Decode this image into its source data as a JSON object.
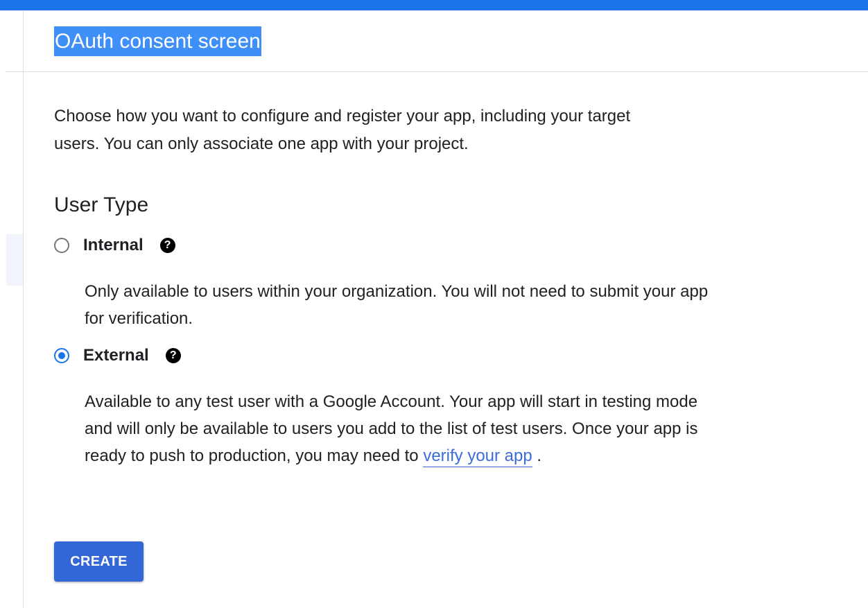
{
  "header": {
    "title": "OAuth consent screen"
  },
  "intro": {
    "text": "Choose how you want to configure and register your app, including your target users. You can only associate one app with your project."
  },
  "user_type": {
    "title": "User Type",
    "selected": "External",
    "options": [
      {
        "label": "Internal",
        "checked": false,
        "help_icon": "question-circle-icon",
        "description": "Only available to users within your organization. You will not need to submit your app for verification."
      },
      {
        "label": "External",
        "checked": true,
        "help_icon": "question-circle-icon",
        "description_before_link": "Available to any test user with a Google Account. Your app will start in testing mode and will only be available to users you add to the list of test users. Once your app is ready to push to production, you may need to",
        "link_text": "verify your app",
        "description_after_link": " ."
      }
    ]
  },
  "actions": {
    "create_label": "CREATE"
  },
  "colors": {
    "accent": "#1a73e8",
    "button": "#3367d6",
    "link": "#3c6cd8",
    "title_highlight": "#3e8ff7"
  }
}
